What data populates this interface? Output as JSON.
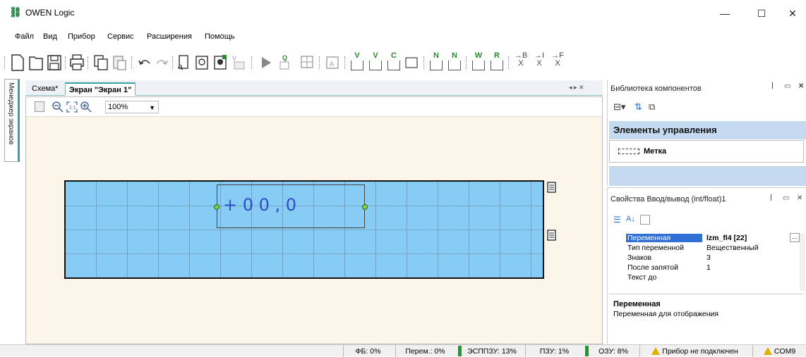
{
  "window": {
    "title": "OWEN Logic",
    "minimize": "—",
    "maximize": "☐",
    "close": "✕"
  },
  "menu": [
    "Файл",
    "Вид",
    "Прибор",
    "Сервис",
    "Расширения",
    "Помощь"
  ],
  "toolbar_text_buttons": [
    {
      "top": "V",
      "name": "add-v-left"
    },
    {
      "top": "V",
      "name": "add-v-right"
    },
    {
      "top": "C",
      "name": "add-c"
    },
    {
      "top": "N",
      "name": "add-n-left"
    },
    {
      "top": "N",
      "name": "add-n-right"
    },
    {
      "top": "W",
      "name": "add-w"
    },
    {
      "top": "R",
      "name": "add-r"
    },
    {
      "top": "→B",
      "name": "goto-b",
      "bottom": "X"
    },
    {
      "top": "→I",
      "name": "goto-i",
      "bottom": "X"
    },
    {
      "top": "→F",
      "name": "goto-f",
      "bottom": "X"
    }
  ],
  "left_dock": {
    "label": "Менеджер экранов"
  },
  "tabs": {
    "schema": "Схема*",
    "screen": "Экран \"Экран 1\"",
    "nav": "◂ ▸ ✕"
  },
  "editor": {
    "zoom": "100%"
  },
  "io_element": {
    "display": "+ 0 0 , 0"
  },
  "library": {
    "title": "Библиотека компонентов",
    "group": "Элементы управления",
    "item": "Метка"
  },
  "properties": {
    "title": "Свойства Ввод/вывод (int/float)1",
    "rows": [
      {
        "key": "Переменная",
        "value": "lzm_fl4 [22]"
      },
      {
        "key": "Тип переменной",
        "value": "Вещественный"
      },
      {
        "key": "Знаков",
        "value": "3"
      },
      {
        "key": "После запятой",
        "value": "1"
      },
      {
        "key": "Текст до",
        "value": ""
      }
    ],
    "desc_title": "Переменная",
    "desc_text": "Переменная для отображения"
  },
  "status": {
    "fb": "ФБ: 0%",
    "vars": "Перем.: 0%",
    "eeprom": "ЭСППЗУ: 13%",
    "rom": "ПЗУ: 1%",
    "ram": "ОЗУ: 8%",
    "device": "Прибор не подключен",
    "port": "COM9"
  },
  "colors": {
    "accent": "#3aa0a0",
    "screen_bg": "#87ccf5",
    "selection": "#2f6fd6",
    "digits": "#2c4ec8",
    "status_green": "#1a9a2a"
  }
}
